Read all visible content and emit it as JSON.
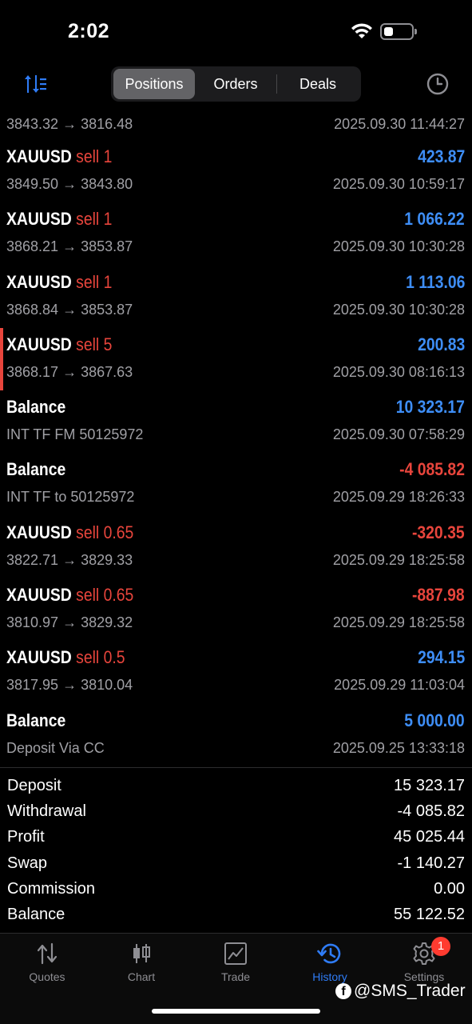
{
  "status": {
    "time": "2:02"
  },
  "header": {
    "tabs": [
      {
        "label": "Positions",
        "active": true
      },
      {
        "label": "Orders",
        "active": false
      },
      {
        "label": "Deals",
        "active": false
      }
    ]
  },
  "deals": [
    {
      "symbol": "",
      "direction": "",
      "amount": "",
      "sub": "3843.32 → 3816.48",
      "date": "2025.09.30 11:44:27"
    },
    {
      "symbol": "XAUUSD",
      "direction": "sell 1",
      "amount": "423.87",
      "sub": "3849.50 → 3843.80",
      "date": "2025.09.30 10:59:17"
    },
    {
      "symbol": "XAUUSD",
      "direction": "sell 1",
      "amount": "1 066.22",
      "sub": "3868.21 → 3853.87",
      "date": "2025.09.30 10:30:28"
    },
    {
      "symbol": "XAUUSD",
      "direction": "sell 1",
      "amount": "1 113.06",
      "sub": "3868.84 → 3853.87",
      "date": "2025.09.30 10:30:28"
    },
    {
      "symbol": "XAUUSD",
      "direction": "sell 5",
      "amount": "200.83",
      "sub": "3868.17 → 3867.63",
      "date": "2025.09.30 08:16:13"
    },
    {
      "symbol": "Balance",
      "direction": "",
      "amount": "10 323.17",
      "sub": "INT TF FM 50125972",
      "date": "2025.09.30 07:58:29"
    },
    {
      "symbol": "Balance",
      "direction": "",
      "amount": "-4 085.82",
      "sub": "INT TF to 50125972",
      "date": "2025.09.29 18:26:33"
    },
    {
      "symbol": "XAUUSD",
      "direction": "sell 0.65",
      "amount": "-320.35",
      "sub": "3822.71 → 3829.33",
      "date": "2025.09.29 18:25:58"
    },
    {
      "symbol": "XAUUSD",
      "direction": "sell 0.65",
      "amount": "-887.98",
      "sub": "3810.97 → 3829.32",
      "date": "2025.09.29 18:25:58"
    },
    {
      "symbol": "XAUUSD",
      "direction": "sell 0.5",
      "amount": "294.15",
      "sub": "3817.95 → 3810.04",
      "date": "2025.09.29 11:03:04"
    },
    {
      "symbol": "Balance",
      "direction": "",
      "amount": "5 000.00",
      "sub": "Deposit Via CC",
      "date": "2025.09.25 13:33:18"
    }
  ],
  "summary": [
    {
      "label": "Deposit",
      "value": "15 323.17"
    },
    {
      "label": "Withdrawal",
      "value": "-4 085.82"
    },
    {
      "label": "Profit",
      "value": "45 025.44"
    },
    {
      "label": "Swap",
      "value": "-1 140.27"
    },
    {
      "label": "Commission",
      "value": "0.00"
    },
    {
      "label": "Balance",
      "value": "55 122.52"
    }
  ],
  "tabbar": {
    "items": [
      {
        "label": "Quotes",
        "icon": "quotes-icon"
      },
      {
        "label": "Chart",
        "icon": "chart-icon"
      },
      {
        "label": "Trade",
        "icon": "trade-icon"
      },
      {
        "label": "History",
        "icon": "history-icon"
      },
      {
        "label": "Settings",
        "icon": "settings-icon"
      }
    ],
    "settings_badge": "1"
  },
  "watermark": "@SMS_Trader",
  "colors": {
    "profit": "#3e8ef7",
    "loss": "#e8453c",
    "accent": "#2f7cf6",
    "badge": "#ff3b30"
  }
}
